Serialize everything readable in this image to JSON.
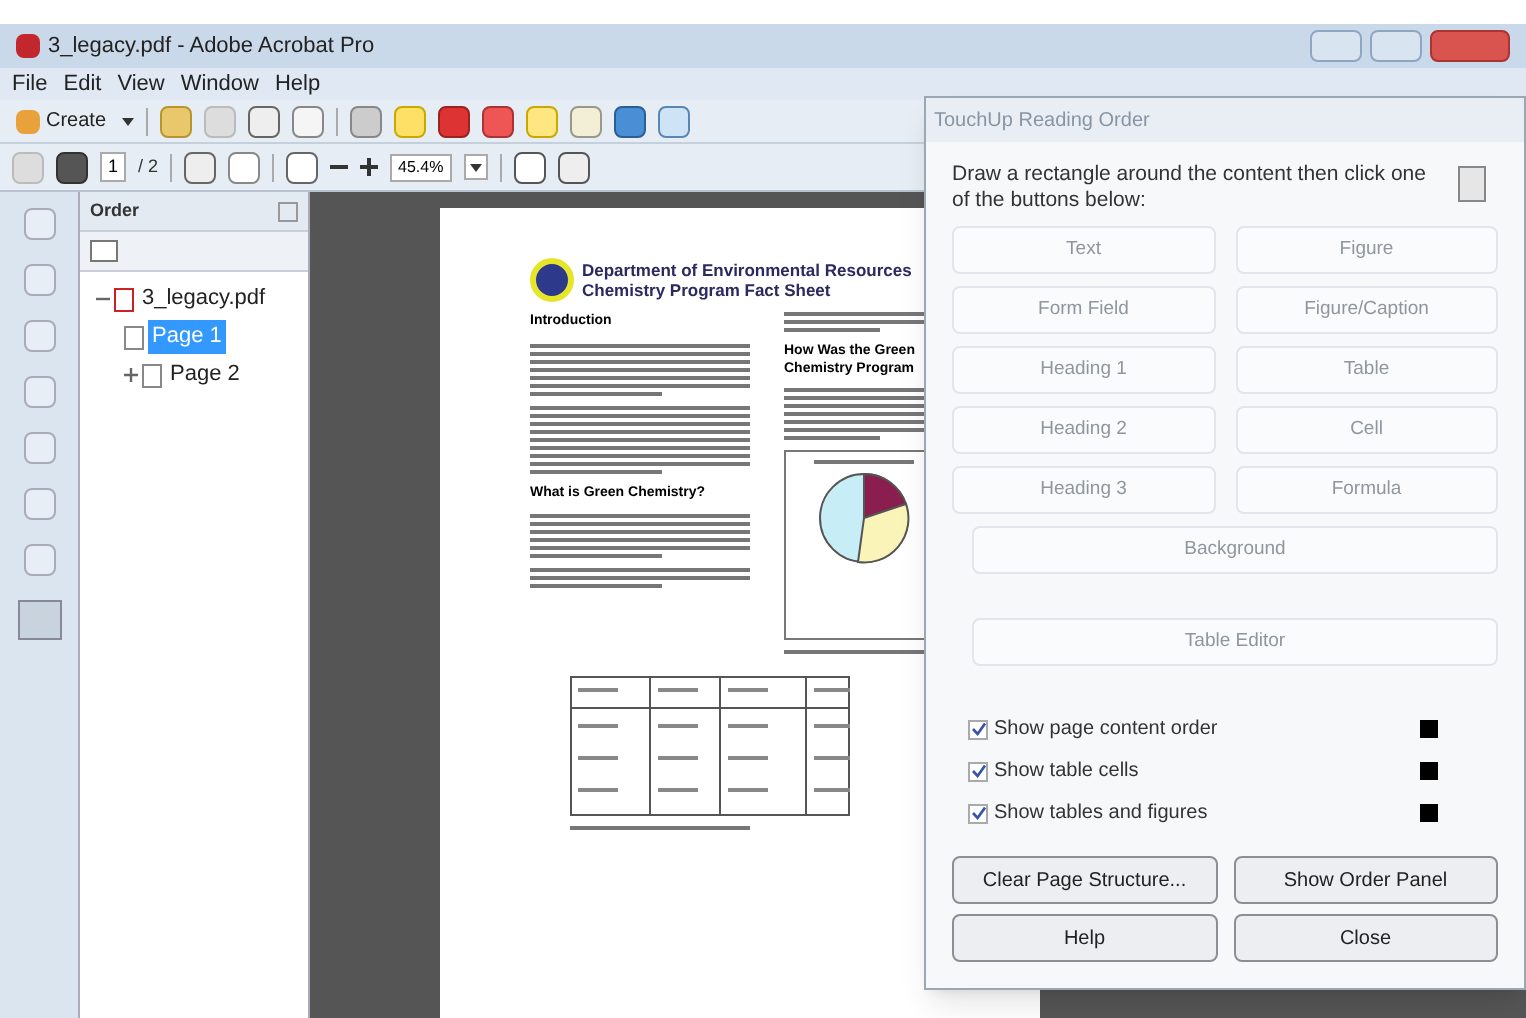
{
  "window": {
    "title": "3_legacy.pdf - Adobe Acrobat Pro"
  },
  "menu": [
    "File",
    "Edit",
    "View",
    "Window",
    "Help"
  ],
  "toolbar": {
    "create": "Create",
    "page_number": "1",
    "page_count": "/ 2",
    "zoom": "45.4%"
  },
  "order_panel": {
    "title": "Order",
    "tree": [
      {
        "label": "3_legacy.pdf",
        "expanded": true,
        "children": [
          {
            "label": "Page 1",
            "selected": true
          },
          {
            "label": "Page 2",
            "selected": false,
            "collapsed_marker": true
          }
        ]
      }
    ]
  },
  "document": {
    "heading_1": "Department of Environmental Resources",
    "heading_2": "Chemistry Program Fact Sheet",
    "section_1": "Introduction",
    "section_2": "What is Green Chemistry?",
    "section_3": "How Was the Green",
    "section_3b": "Chemistry Program"
  },
  "dialog": {
    "title": "TouchUp Reading Order",
    "instruction": "Draw a rectangle around the content then click one of the buttons below:",
    "buttons": [
      {
        "label": "Text",
        "disabled": true
      },
      {
        "label": "Figure",
        "disabled": true
      },
      {
        "label": "Form Field",
        "disabled": true
      },
      {
        "label": "Figure/Caption",
        "disabled": true
      },
      {
        "label": "Heading 1",
        "disabled": true
      },
      {
        "label": "Table",
        "disabled": true
      },
      {
        "label": "Heading 2",
        "disabled": true
      },
      {
        "label": "Cell",
        "disabled": true
      },
      {
        "label": "Heading 3",
        "disabled": true
      },
      {
        "label": "Formula",
        "disabled": true
      }
    ],
    "wide_buttons": [
      {
        "label": "Background",
        "disabled": true
      },
      {
        "label": "Table Editor",
        "disabled": true
      }
    ],
    "options": [
      {
        "label": "Show page content order",
        "checked": true,
        "color": "#000000"
      },
      {
        "label": "Show table cells",
        "checked": true,
        "color": "#000000"
      },
      {
        "label": "Show tables and figures",
        "checked": true,
        "color": "#000000"
      }
    ],
    "actions": [
      "Clear Page Structure...",
      "Show Order Panel",
      "Help",
      "Close"
    ]
  }
}
